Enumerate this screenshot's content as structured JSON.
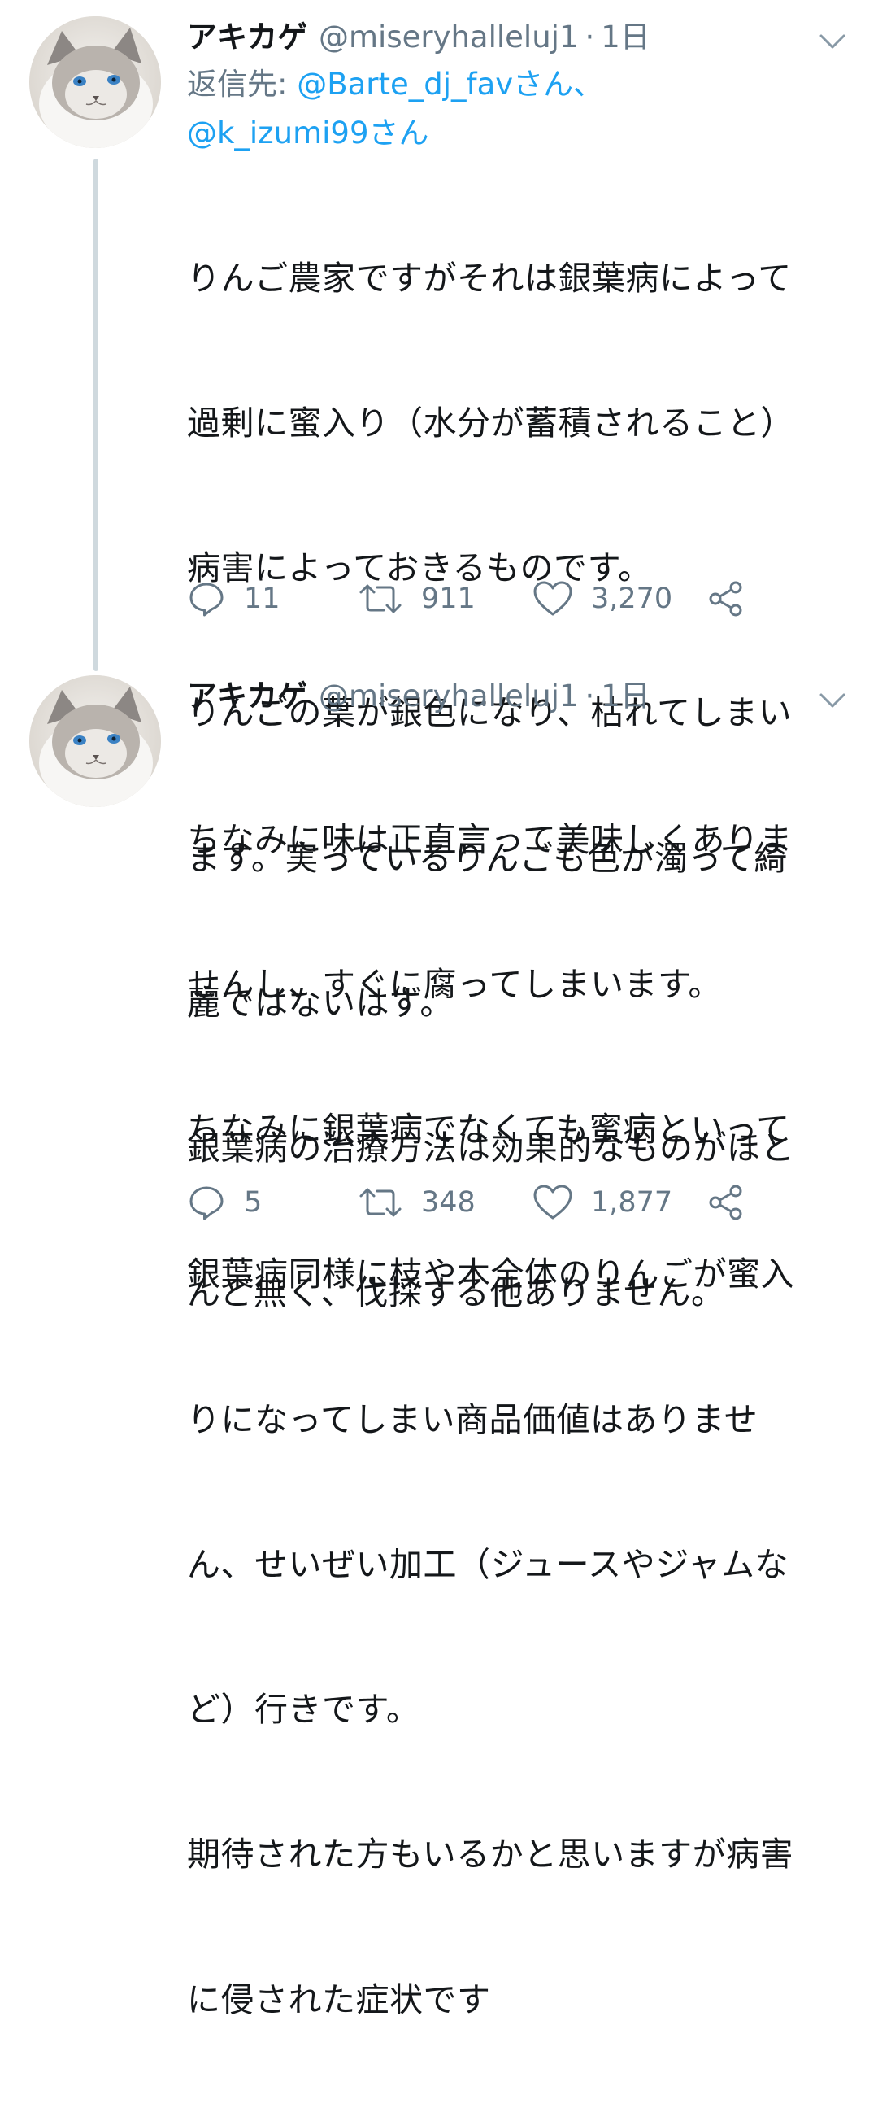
{
  "tweets": [
    {
      "display_name": "アキカゲ",
      "handle": "@miseryhalleluj1",
      "separator": "·",
      "time": "1日",
      "reply_label": "返信先: ",
      "reply_mentions": [
        "@Barte_dj_favさん、",
        "@k_izumi99さん"
      ],
      "text_lines": [
        "りんご農家ですがそれは銀葉病によって",
        "過剰に蜜入り（水分が蓄積されること）",
        "病害によっておきるものです。",
        "りんごの葉が銀色になり、枯れてしまい",
        "ます。実っているりんごも色が濁って綺",
        "麗ではないはず。",
        "銀葉病の治療方法は効果的なものがほと",
        "んど無く、伐採する他ありません。"
      ],
      "replies": "11",
      "retweets": "911",
      "likes": "3,270"
    },
    {
      "display_name": "アキカゲ",
      "handle": "@miseryhalleluj1",
      "separator": "·",
      "time": "1日",
      "text_lines": [
        "ちなみに味は正直言って美味しくありま",
        "せんし、すぐに腐ってしまいます。",
        "ちなみに銀葉病でなくても蜜病といって",
        "銀葉病同様に枝や木全体のりんごが蜜入",
        "りになってしまい商品価値はありませ",
        "ん、せいぜい加工（ジュースやジャムな",
        "ど）行きです。",
        "期待された方もいるかと思いますが病害",
        "に侵された症状です"
      ],
      "replies": "5",
      "retweets": "348",
      "likes": "1,877"
    }
  ],
  "colors": {
    "text": "#14171a",
    "secondary": "#657786",
    "link": "#1da1f2",
    "thread_line": "#cfd9de"
  },
  "icons": {
    "reply": "speech-bubble-icon",
    "retweet": "retweet-icon",
    "like": "heart-icon",
    "share": "share-icon",
    "menu": "chevron-down-icon"
  }
}
